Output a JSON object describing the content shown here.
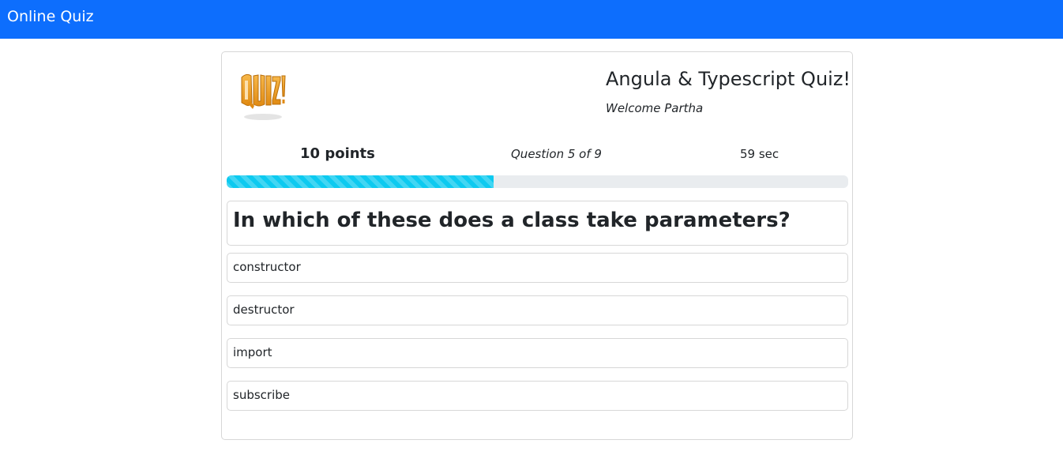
{
  "navbar": {
    "brand": "Online Quiz"
  },
  "quiz": {
    "logo_text": "QUIZ!",
    "title": "Angula & Typescript Quiz!",
    "welcome": "Welcome Partha",
    "points": "10 points",
    "question_counter": "Question 5 of 9",
    "timer": "59 sec",
    "progress_fraction": 0.43,
    "question": "In which of these does a class take parameters?",
    "options": [
      {
        "label": "constructor"
      },
      {
        "label": "destructor"
      },
      {
        "label": "import"
      },
      {
        "label": "subscribe"
      }
    ]
  },
  "colors": {
    "navbar_bg": "#0d6efd",
    "progress_fill": "#0dcaf0",
    "progress_track": "#e9ecef",
    "logo_orange": "#f29b1d"
  }
}
